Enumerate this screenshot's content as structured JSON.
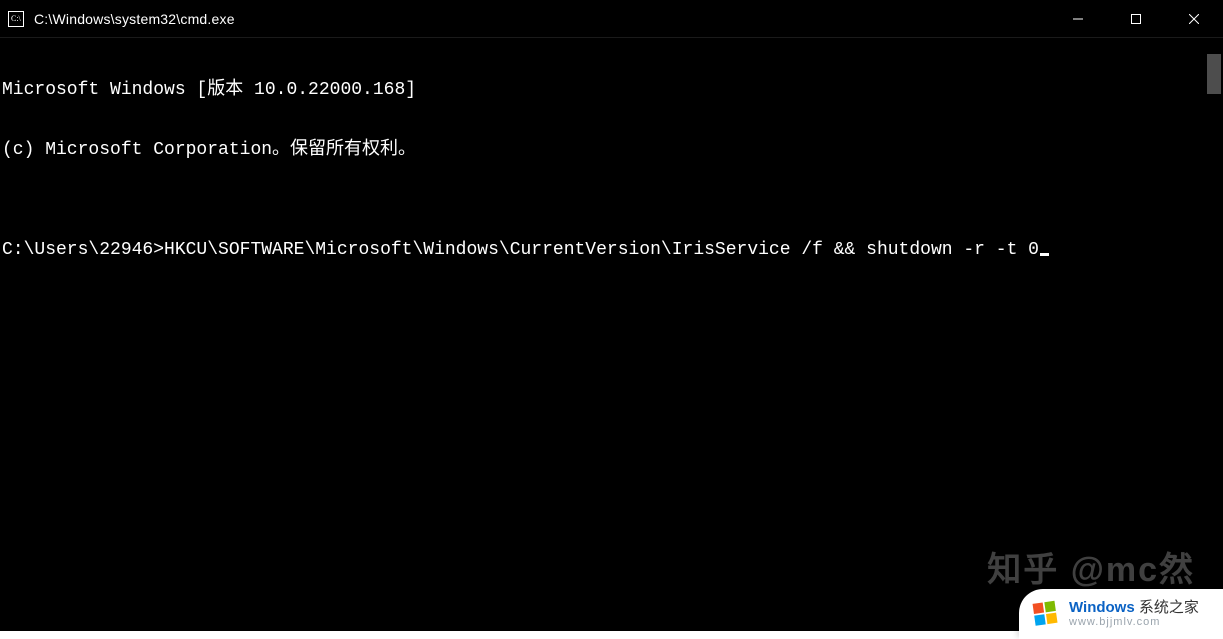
{
  "window": {
    "title": "C:\\Windows\\system32\\cmd.exe",
    "icon": "cmd-icon"
  },
  "controls": {
    "minimize": "minimize-icon",
    "maximize": "maximize-icon",
    "close": "close-icon"
  },
  "terminal": {
    "line1": "Microsoft Windows [版本 10.0.22000.168]",
    "line2": "(c) Microsoft Corporation。保留所有权利。",
    "blank": "",
    "prompt": "C:\\Users\\22946>",
    "command": "HKCU\\SOFTWARE\\Microsoft\\Windows\\CurrentVersion\\IrisService /f && shutdown -r -t 0"
  },
  "watermarks": {
    "zhihu": "知乎 @mc然",
    "brand_prefix": "Windows",
    "brand_suffix": " 系统之家",
    "brand_url": "www.bjjmlv.com"
  },
  "colors": {
    "bg": "#000000",
    "fg": "#ffffff",
    "scrollbar_thumb": "#4d4d4d"
  }
}
